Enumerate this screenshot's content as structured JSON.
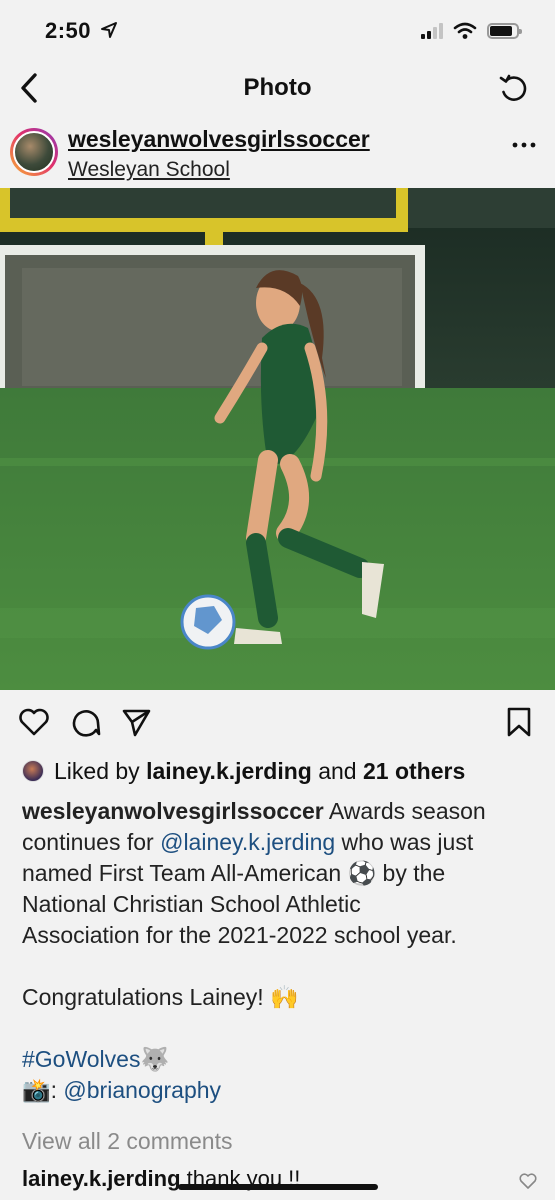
{
  "status_bar": {
    "time": "2:50"
  },
  "nav": {
    "title": "Photo"
  },
  "post": {
    "username": "wesleyanwolvesgirlssoccer",
    "location": "Wesleyan School"
  },
  "likes": {
    "prefix": "Liked by ",
    "user": "lainey.k.jerding",
    "middle": " and ",
    "others": "21 others"
  },
  "caption": {
    "author": "wesleyanwolvesgirlssoccer",
    "l1_text": " Awards season",
    "l2_a": "continues for ",
    "l2_mention": "@lainey.k.jerding",
    "l2_b": " who was just",
    "l3": "named First Team All-American ⚽ by the",
    "l4": "National Christian School Athletic",
    "l5": "Association for the 2021-2022 school year.",
    "l6": "Congratulations Lainey! 🙌",
    "hashtag": "#GoWolves🐺",
    "camera": "📸",
    "camera_sep": ": ",
    "photographer": "@brianography"
  },
  "comments": {
    "view_all": "View all 2 comments",
    "first_user": "lainey.k.jerding",
    "first_text": " thank you !!"
  }
}
